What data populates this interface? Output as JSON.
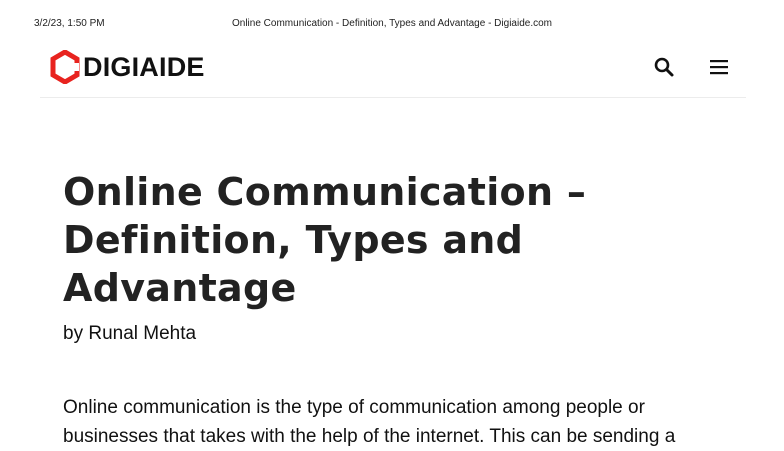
{
  "print_header": {
    "datetime": "3/2/23, 1:50 PM",
    "page_title": "Online Communication - Definition, Types and Advantage - Digiaide.com"
  },
  "site": {
    "logo_text": "DIGIAIDE",
    "logo_color": "#e8231f",
    "search_icon": "search-icon",
    "menu_icon": "hamburger-menu-icon"
  },
  "article": {
    "title": "Online Communication – Definition, Types and Advantage",
    "byline_prefix": "by",
    "author": "Runal Mehta",
    "intro": "Online communication is the type of communication among people or businesses that takes with the help of the internet. This can be sending a"
  }
}
